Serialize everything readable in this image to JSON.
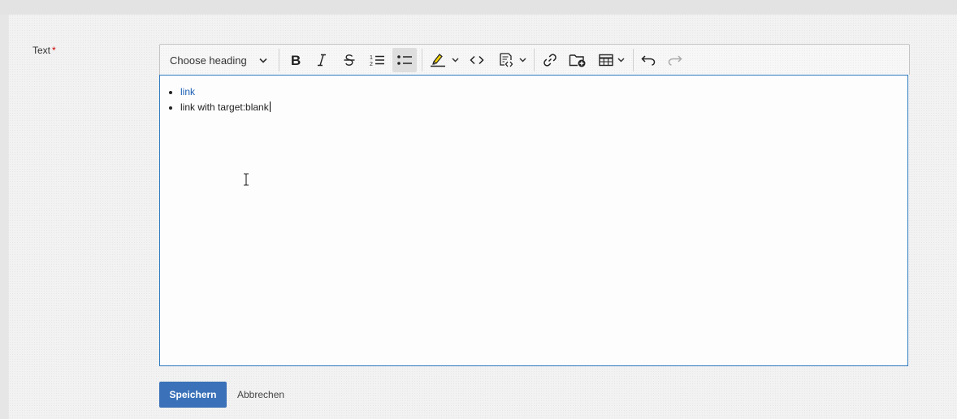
{
  "field": {
    "label": "Text",
    "required_marker": "*"
  },
  "toolbar": {
    "heading_dropdown": "Choose heading",
    "buttons": [
      {
        "name": "bold",
        "icon": "bold-icon"
      },
      {
        "name": "italic",
        "icon": "italic-icon"
      },
      {
        "name": "strikethrough",
        "icon": "strikethrough-icon"
      },
      {
        "name": "numbered-list",
        "icon": "numbered-list-icon"
      },
      {
        "name": "bulleted-list",
        "icon": "bulleted-list-icon",
        "active": true
      },
      {
        "name": "highlight",
        "icon": "highlighter-icon",
        "has_dropdown": true
      },
      {
        "name": "code",
        "icon": "code-icon"
      },
      {
        "name": "source-editing",
        "icon": "source-icon",
        "has_dropdown": true
      },
      {
        "name": "link",
        "icon": "link-icon"
      },
      {
        "name": "file-manager",
        "icon": "folder-add-icon"
      },
      {
        "name": "table",
        "icon": "table-icon",
        "has_dropdown": true
      },
      {
        "name": "undo",
        "icon": "undo-icon"
      },
      {
        "name": "redo",
        "icon": "redo-icon",
        "disabled": true
      }
    ]
  },
  "content": {
    "items": [
      {
        "text": "link",
        "is_link": true
      },
      {
        "text": "link with target:blank",
        "is_link": false
      }
    ]
  },
  "actions": {
    "save_label": "Speichern",
    "cancel_label": "Abbrechen"
  },
  "colors": {
    "accent": "#3a71b8",
    "link": "#1a5fb4",
    "focus_border": "#2f7bc0",
    "required": "#cc0000"
  }
}
